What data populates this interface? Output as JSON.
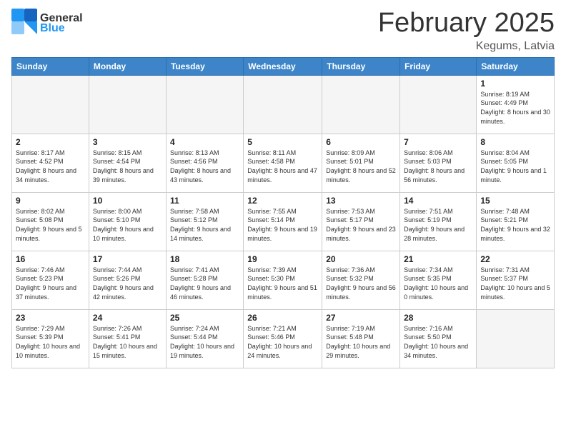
{
  "header": {
    "logo_general": "General",
    "logo_blue": "Blue",
    "title": "February 2025",
    "subtitle": "Kegums, Latvia"
  },
  "weekdays": [
    "Sunday",
    "Monday",
    "Tuesday",
    "Wednesday",
    "Thursday",
    "Friday",
    "Saturday"
  ],
  "weeks": [
    [
      {
        "day": "",
        "info": ""
      },
      {
        "day": "",
        "info": ""
      },
      {
        "day": "",
        "info": ""
      },
      {
        "day": "",
        "info": ""
      },
      {
        "day": "",
        "info": ""
      },
      {
        "day": "",
        "info": ""
      },
      {
        "day": "1",
        "info": "Sunrise: 8:19 AM\nSunset: 4:49 PM\nDaylight: 8 hours and 30 minutes."
      }
    ],
    [
      {
        "day": "2",
        "info": "Sunrise: 8:17 AM\nSunset: 4:52 PM\nDaylight: 8 hours and 34 minutes."
      },
      {
        "day": "3",
        "info": "Sunrise: 8:15 AM\nSunset: 4:54 PM\nDaylight: 8 hours and 39 minutes."
      },
      {
        "day": "4",
        "info": "Sunrise: 8:13 AM\nSunset: 4:56 PM\nDaylight: 8 hours and 43 minutes."
      },
      {
        "day": "5",
        "info": "Sunrise: 8:11 AM\nSunset: 4:58 PM\nDaylight: 8 hours and 47 minutes."
      },
      {
        "day": "6",
        "info": "Sunrise: 8:09 AM\nSunset: 5:01 PM\nDaylight: 8 hours and 52 minutes."
      },
      {
        "day": "7",
        "info": "Sunrise: 8:06 AM\nSunset: 5:03 PM\nDaylight: 8 hours and 56 minutes."
      },
      {
        "day": "8",
        "info": "Sunrise: 8:04 AM\nSunset: 5:05 PM\nDaylight: 9 hours and 1 minute."
      }
    ],
    [
      {
        "day": "9",
        "info": "Sunrise: 8:02 AM\nSunset: 5:08 PM\nDaylight: 9 hours and 5 minutes."
      },
      {
        "day": "10",
        "info": "Sunrise: 8:00 AM\nSunset: 5:10 PM\nDaylight: 9 hours and 10 minutes."
      },
      {
        "day": "11",
        "info": "Sunrise: 7:58 AM\nSunset: 5:12 PM\nDaylight: 9 hours and 14 minutes."
      },
      {
        "day": "12",
        "info": "Sunrise: 7:55 AM\nSunset: 5:14 PM\nDaylight: 9 hours and 19 minutes."
      },
      {
        "day": "13",
        "info": "Sunrise: 7:53 AM\nSunset: 5:17 PM\nDaylight: 9 hours and 23 minutes."
      },
      {
        "day": "14",
        "info": "Sunrise: 7:51 AM\nSunset: 5:19 PM\nDaylight: 9 hours and 28 minutes."
      },
      {
        "day": "15",
        "info": "Sunrise: 7:48 AM\nSunset: 5:21 PM\nDaylight: 9 hours and 32 minutes."
      }
    ],
    [
      {
        "day": "16",
        "info": "Sunrise: 7:46 AM\nSunset: 5:23 PM\nDaylight: 9 hours and 37 minutes."
      },
      {
        "day": "17",
        "info": "Sunrise: 7:44 AM\nSunset: 5:26 PM\nDaylight: 9 hours and 42 minutes."
      },
      {
        "day": "18",
        "info": "Sunrise: 7:41 AM\nSunset: 5:28 PM\nDaylight: 9 hours and 46 minutes."
      },
      {
        "day": "19",
        "info": "Sunrise: 7:39 AM\nSunset: 5:30 PM\nDaylight: 9 hours and 51 minutes."
      },
      {
        "day": "20",
        "info": "Sunrise: 7:36 AM\nSunset: 5:32 PM\nDaylight: 9 hours and 56 minutes."
      },
      {
        "day": "21",
        "info": "Sunrise: 7:34 AM\nSunset: 5:35 PM\nDaylight: 10 hours and 0 minutes."
      },
      {
        "day": "22",
        "info": "Sunrise: 7:31 AM\nSunset: 5:37 PM\nDaylight: 10 hours and 5 minutes."
      }
    ],
    [
      {
        "day": "23",
        "info": "Sunrise: 7:29 AM\nSunset: 5:39 PM\nDaylight: 10 hours and 10 minutes."
      },
      {
        "day": "24",
        "info": "Sunrise: 7:26 AM\nSunset: 5:41 PM\nDaylight: 10 hours and 15 minutes."
      },
      {
        "day": "25",
        "info": "Sunrise: 7:24 AM\nSunset: 5:44 PM\nDaylight: 10 hours and 19 minutes."
      },
      {
        "day": "26",
        "info": "Sunrise: 7:21 AM\nSunset: 5:46 PM\nDaylight: 10 hours and 24 minutes."
      },
      {
        "day": "27",
        "info": "Sunrise: 7:19 AM\nSunset: 5:48 PM\nDaylight: 10 hours and 29 minutes."
      },
      {
        "day": "28",
        "info": "Sunrise: 7:16 AM\nSunset: 5:50 PM\nDaylight: 10 hours and 34 minutes."
      },
      {
        "day": "",
        "info": ""
      }
    ]
  ]
}
